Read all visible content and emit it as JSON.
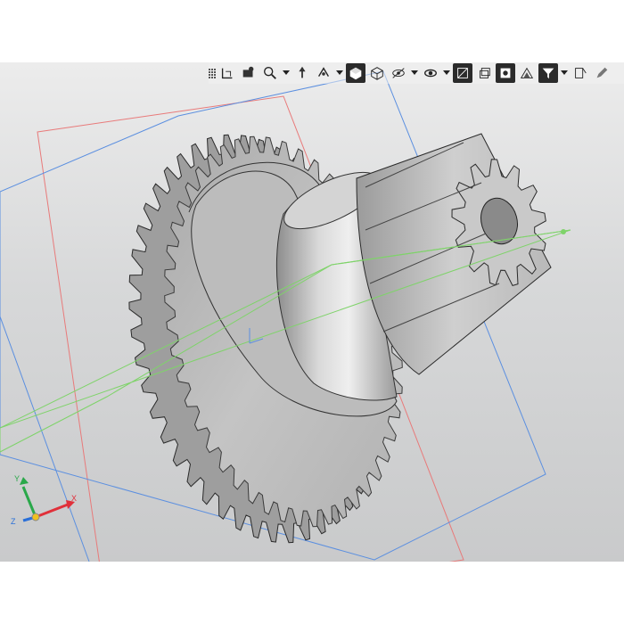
{
  "toolbar": {
    "buttons": [
      {
        "name": "grip"
      },
      {
        "name": "orient-icon"
      },
      {
        "name": "camera-icon"
      },
      {
        "name": "zoom-icon",
        "dropdown": true
      },
      {
        "name": "pan-icon"
      },
      {
        "name": "rotate-axis-icon",
        "dropdown": true
      },
      {
        "name": "shaded-cube-icon",
        "active": true
      },
      {
        "name": "wireframe-cube-icon"
      },
      {
        "name": "visibility-icon",
        "dropdown": true
      },
      {
        "name": "view-eye-icon",
        "dropdown": true
      },
      {
        "name": "section-icon",
        "active": true
      },
      {
        "name": "layers-icon"
      },
      {
        "name": "display-mode-icon",
        "active": true
      },
      {
        "name": "perspective-icon"
      },
      {
        "name": "filter-icon",
        "active": true,
        "dropdown": true
      },
      {
        "name": "measure-icon"
      },
      {
        "name": "pencil-icon"
      }
    ]
  },
  "triad": {
    "x_label": "X",
    "y_label": "Y",
    "z_label": "Z",
    "x_color": "#e0303a",
    "y_color": "#2aa84a",
    "z_color": "#2a6fd8"
  },
  "colors": {
    "plane_red": "#e87a7a",
    "plane_blue": "#5b8fe0",
    "plane_green": "#7fd36a",
    "gear_body": "#bdbdbd"
  }
}
